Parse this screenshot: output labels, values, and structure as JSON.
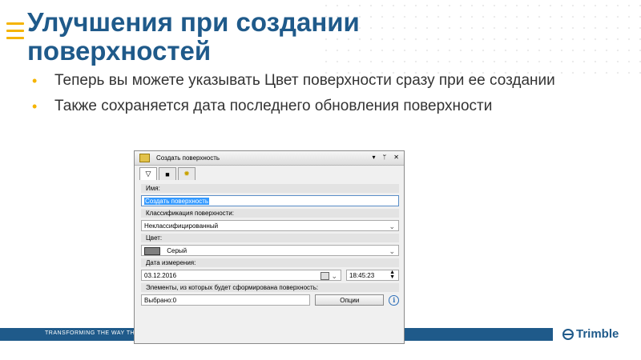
{
  "slide": {
    "title_line1": "Улучшения при создании",
    "title_line2": "поверхностей",
    "bullets": [
      {
        "text": "Теперь вы можете указывать Цвет поверхности сразу при ее создании"
      },
      {
        "text": "Также сохраняется дата последнего обновления поверхности"
      }
    ],
    "bullet_marker": "•",
    "footer_slogan": "TRANSFORMING THE WAY THE WORLD",
    "logo_text": "Trimble",
    "colors": {
      "title": "#1f5a8a",
      "accent": "#f5b400",
      "footer": "#1f5a8a"
    }
  },
  "panel": {
    "title": "Создать поверхность",
    "pin_glyph": "▾",
    "pin_icon": "ᛘ",
    "close_glyph": "✕",
    "tools": [
      {
        "icon": "filter-triangle-icon",
        "glyph": "▽"
      },
      {
        "icon": "surface-icon",
        "glyph": "■"
      },
      {
        "icon": "gear-icon",
        "glyph": "✹"
      }
    ],
    "name_label": "Имя:",
    "name_value": "Создать поверхность",
    "class_label": "Классификация поверхности:",
    "class_value": "Неклассифицированный",
    "color_label": "Цвет:",
    "color_value": "Серый",
    "color_swatch": "#7f7f7f",
    "date_label": "Дата измерения:",
    "date_value": "03.12.2016",
    "time_value": "18:45:23",
    "elements_label": "Элементы, из которых будет сформирована поверхность:",
    "selected_value": "Выбрано:0",
    "options_button": "Опции",
    "info_glyph": "i",
    "dropdown_glyph": "⌄",
    "spin_up": "▲",
    "spin_down": "▼"
  }
}
